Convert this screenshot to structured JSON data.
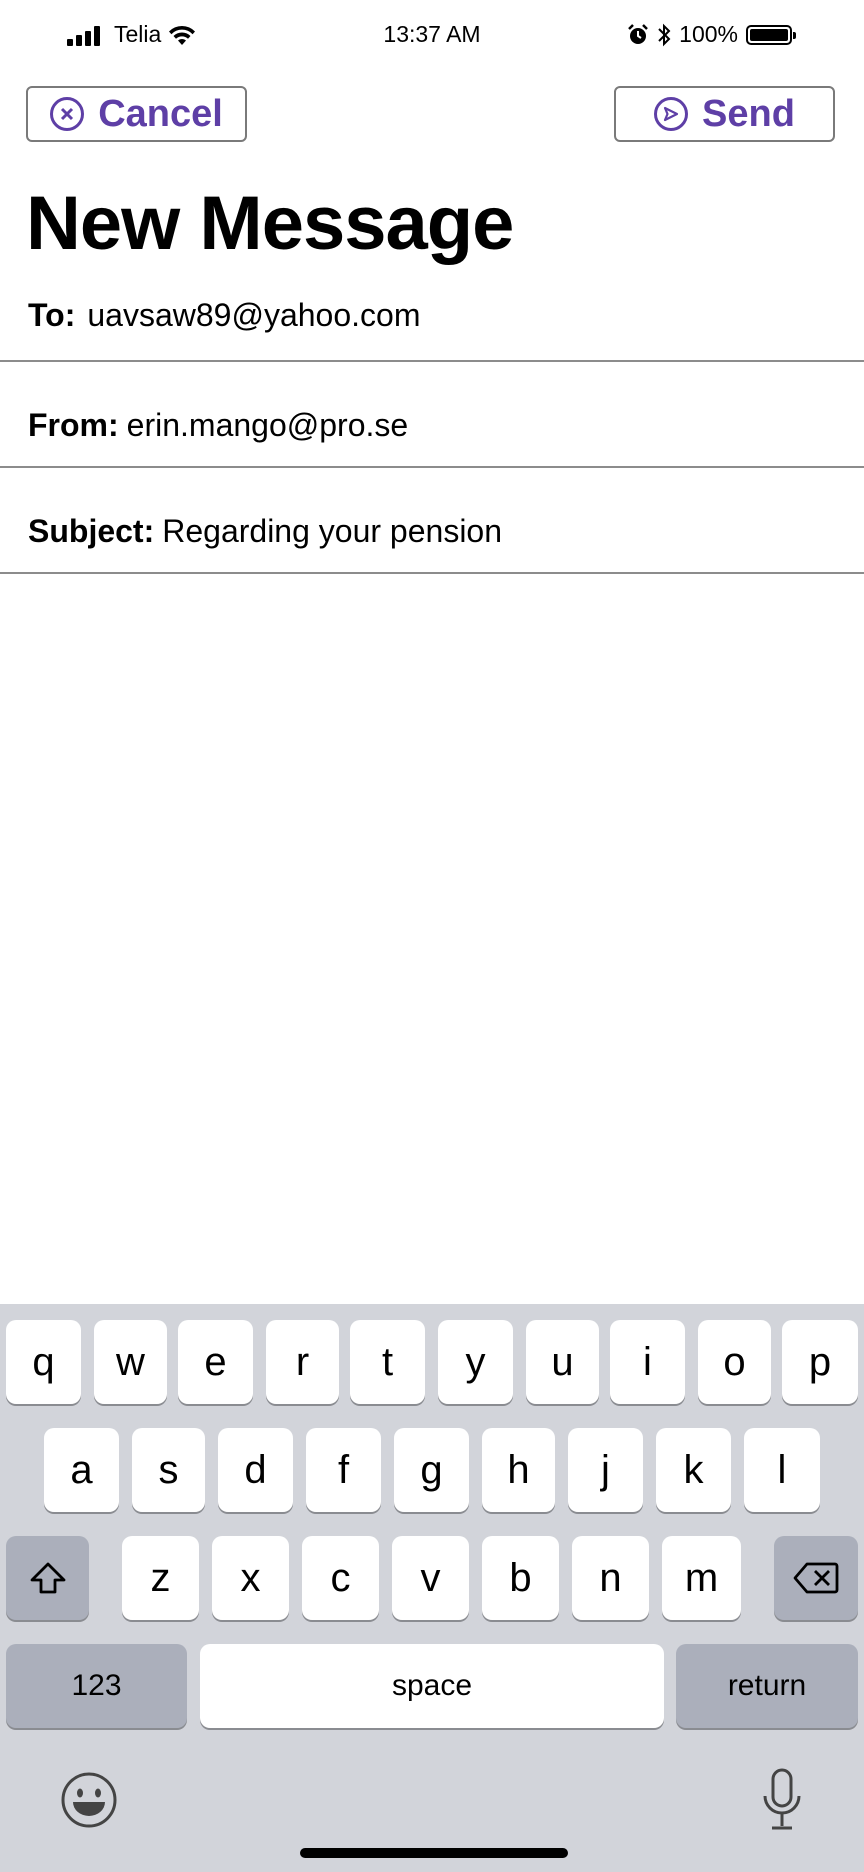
{
  "status_bar": {
    "carrier": "Telia",
    "time": "13:37 AM",
    "battery": "100%",
    "icons": [
      "signal-icon",
      "wifi-icon",
      "alarm-icon",
      "bluetooth-icon",
      "battery-icon"
    ]
  },
  "toolbar": {
    "cancel_label": "Cancel",
    "send_label": "Send",
    "cancel_icon": "close-circle-icon",
    "send_icon": "send-circle-icon",
    "accent": "#5e3fa6"
  },
  "compose": {
    "title": "New Message",
    "to_label": "To:",
    "to_value": "uavsaw89@yahoo.com",
    "from_label": "From:",
    "from_value": "erin.mango@pro.se",
    "subject_label": "Subject:",
    "subject_value": "Regarding your pension",
    "body": ""
  },
  "keyboard": {
    "row1": [
      "q",
      "w",
      "e",
      "r",
      "t",
      "y",
      "u",
      "i",
      "o",
      "p"
    ],
    "row2": [
      "a",
      "s",
      "d",
      "f",
      "g",
      "h",
      "j",
      "k",
      "l"
    ],
    "row3": [
      "z",
      "x",
      "c",
      "v",
      "b",
      "n",
      "m"
    ],
    "numbers_label": "123",
    "space_label": "space",
    "return_label": "return",
    "icons": [
      "shift-icon",
      "backspace-icon",
      "emoji-icon",
      "microphone-icon"
    ]
  }
}
